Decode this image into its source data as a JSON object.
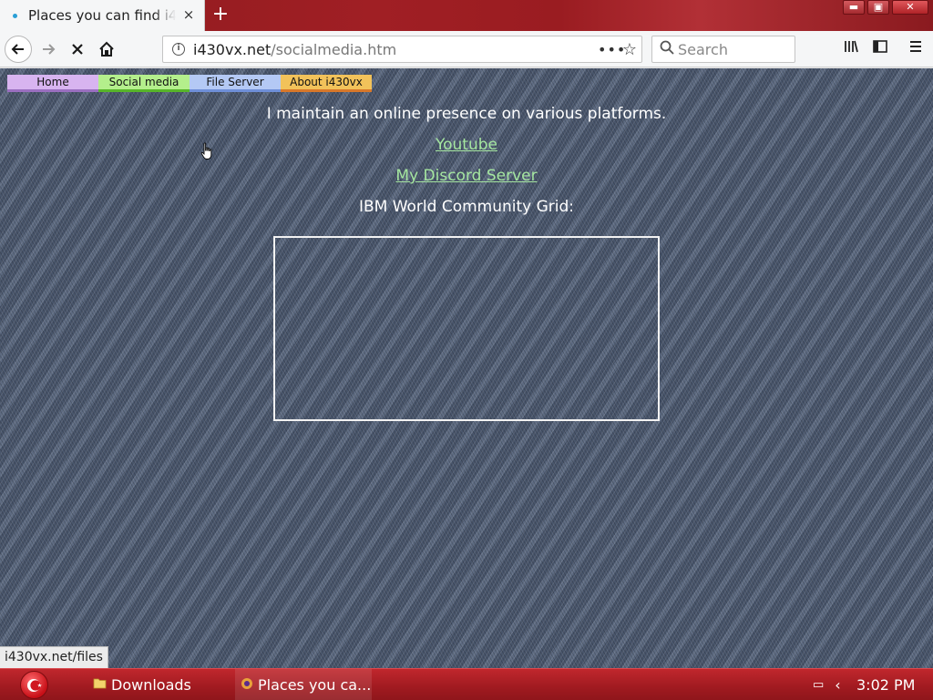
{
  "browser": {
    "tab_title": "Places you can find i430vx",
    "tab_close": "×",
    "new_tab": "+",
    "window_buttons": {
      "minimize": "▬",
      "maximize": "▣",
      "close": "✕"
    },
    "url_host": "i430vx.net",
    "url_path": "/socialmedia.htm",
    "url_actions_label": "•••",
    "bookmark_star": "☆",
    "search_placeholder": "Search",
    "icons": {
      "back": "🡐",
      "forward": "→",
      "stop": "✕",
      "home": "⌂",
      "info": "i",
      "search": "🔍",
      "library": "|||\\",
      "sidebar": "◧",
      "menu": "☰"
    }
  },
  "page": {
    "menu": [
      {
        "label": "Home"
      },
      {
        "label": "Social media"
      },
      {
        "label": "File Server"
      },
      {
        "label": "About i430vx"
      }
    ],
    "intro": "I maintain an online presence on various platforms.",
    "links": [
      {
        "label": "Youtube"
      },
      {
        "label": "My Discord Server"
      }
    ],
    "wcg_label": "IBM World Community Grid:",
    "status_link": "i430vx.net/files",
    "colors": {
      "home": "#d8b4f0",
      "social": "#b4ef8c",
      "files": "#b4c9f5",
      "about": "#f2c25a",
      "link": "#a5e6a0"
    }
  },
  "taskbar": {
    "start_icon": "crescent-star-icon",
    "items": [
      {
        "label": "Downloads",
        "icon": "folder-icon"
      },
      {
        "label": "Places you ca...",
        "icon": "browser-icon"
      }
    ],
    "tray_keyboard": "▭",
    "tray_chevron": "‹",
    "clock": "3:02 PM"
  }
}
